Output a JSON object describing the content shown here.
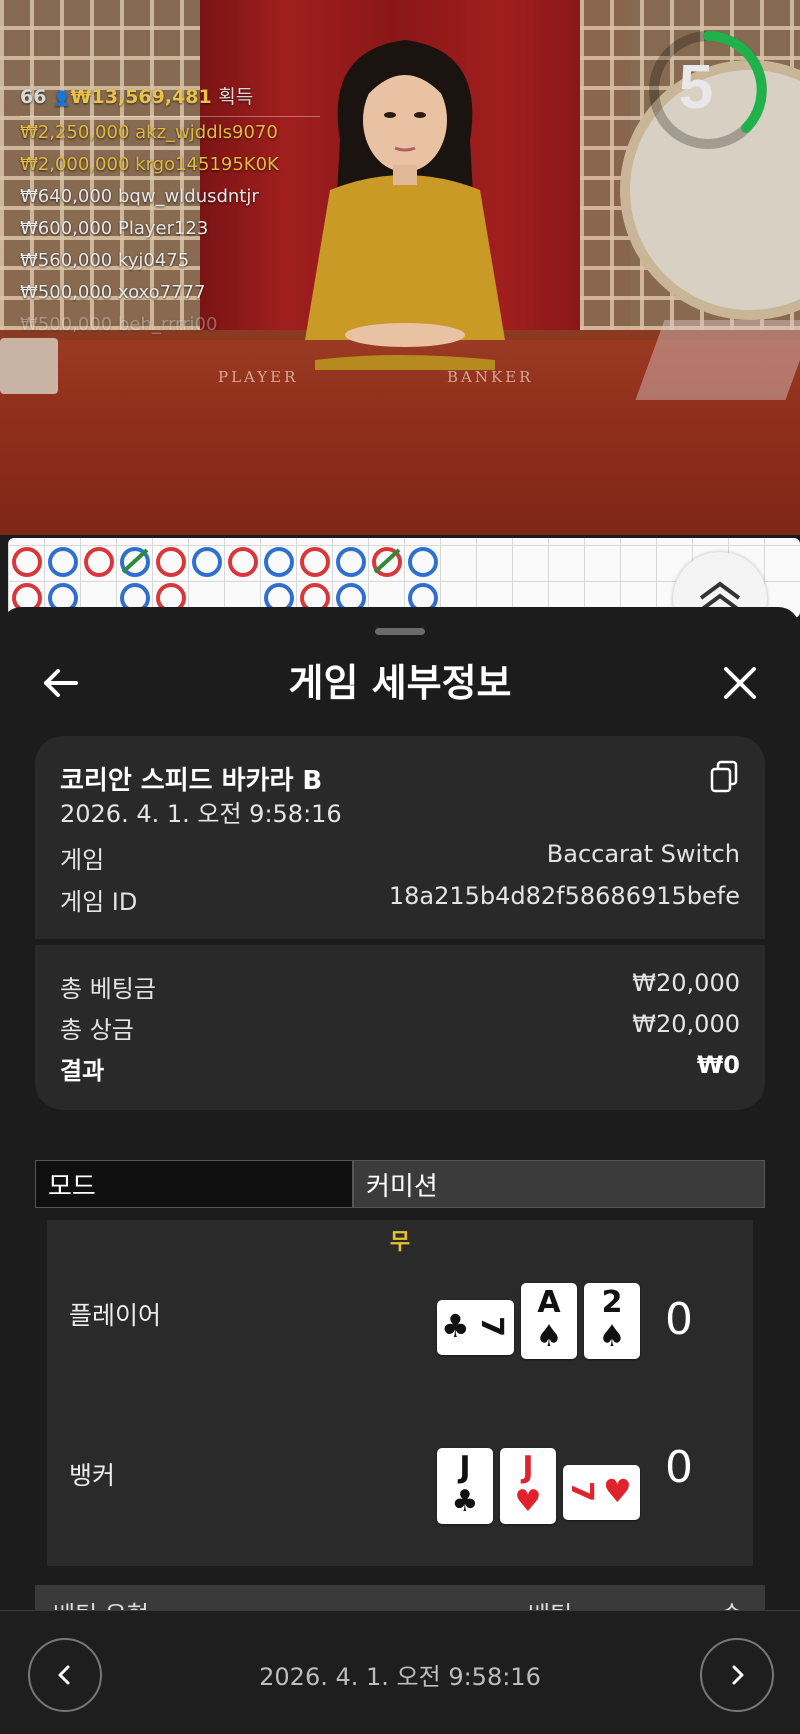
{
  "stream": {
    "timer_value": "5",
    "table_labels": {
      "player": "PLAYER",
      "banker": "BANKER"
    },
    "winners": {
      "count": "66",
      "total": "₩13,569,481",
      "suffix": "획득",
      "rows": [
        {
          "amount": "₩2,250,000",
          "name": "akz_wjddls9070"
        },
        {
          "amount": "₩2,000,000",
          "name": "krgo145195K0K"
        },
        {
          "amount": "₩640,000",
          "name": "bqw_wldusdntjr"
        },
        {
          "amount": "₩600,000",
          "name": "Player123"
        },
        {
          "amount": "₩560,000",
          "name": "kyj0475"
        },
        {
          "amount": "₩500,000",
          "name": "xoxo7777"
        },
        {
          "amount": "₩500,000",
          "name": "beh_rrrri00"
        }
      ]
    }
  },
  "panel": {
    "title": "게임 세부정보",
    "game_name": "코리안 스피드 바카라 B",
    "datetime": "2026. 4. 1. 오전 9:58:16",
    "game_label": "게임",
    "game_value": "Baccarat Switch",
    "game_id_label": "게임 ID",
    "game_id_value": "18a215b4d82f58686915befe",
    "total_bet_label": "총 베팅금",
    "total_bet_value": "₩20,000",
    "total_win_label": "총 상금",
    "total_win_value": "₩20,000",
    "result_label": "결과",
    "result_value": "₩0",
    "tabs": [
      "모드",
      "커미션"
    ],
    "outcome": "무",
    "player_label": "플레이어",
    "player_score": "0",
    "banker_label": "뱅커",
    "banker_score": "0",
    "player_cards": [
      {
        "rank": "7",
        "suit": "♣",
        "color": "black",
        "orientation": "horizontal"
      },
      {
        "rank": "A",
        "suit": "♠",
        "color": "black",
        "orientation": "vertical"
      },
      {
        "rank": "2",
        "suit": "♠",
        "color": "black",
        "orientation": "vertical"
      }
    ],
    "banker_cards": [
      {
        "rank": "J",
        "suit": "♣",
        "color": "black",
        "orientation": "vertical"
      },
      {
        "rank": "J",
        "suit": "♥",
        "color": "red",
        "orientation": "vertical"
      },
      {
        "rank": "7",
        "suit": "♥",
        "color": "red",
        "orientation": "horizontal"
      }
    ],
    "bet_table_headers": [
      "베팅 유형",
      "베팅",
      "승"
    ]
  },
  "footer": {
    "datetime": "2026. 4. 1. 오전 9:58:16"
  },
  "colors": {
    "accent_gold": "#e7c02e",
    "player_blue": "#2f6fd0",
    "banker_red": "#d9383a",
    "tie_green": "#2e8b3a",
    "timer_green": "#1fb24a"
  }
}
